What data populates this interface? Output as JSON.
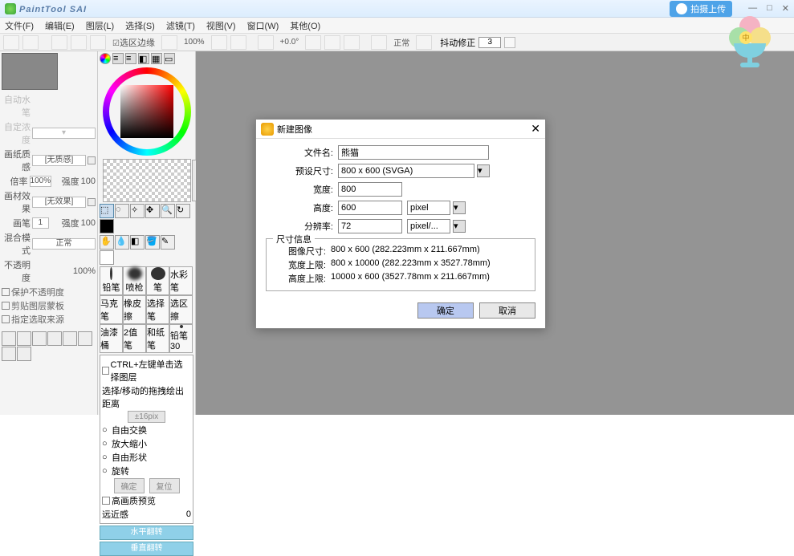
{
  "app": {
    "title": "PaintTool SAI",
    "upload_label": "拍摄上传"
  },
  "menu": [
    "文件(F)",
    "编辑(E)",
    "图层(L)",
    "选择(S)",
    "滤镜(T)",
    "视图(V)",
    "窗口(W)",
    "其他(O)"
  ],
  "toolbar": {
    "select_border": "选区边缘",
    "zoom": "100%",
    "angle": "+0.0°",
    "mode": "正常",
    "jitter_label": "抖动修正",
    "jitter_value": "3"
  },
  "left": {
    "paper_quality": "画纸质感",
    "paper_value": "[无质感]",
    "rate_label": "倍率",
    "rate_value": "100%",
    "intensity_label": "强度",
    "intensity_value": "100",
    "material_effect": "画材效果",
    "material_value": "[无效果]",
    "width_label": "画笔",
    "width_value": "1",
    "blend_label": "混合模式",
    "blend_value": "正常",
    "opacity_label": "不透明度",
    "opacity_value": "100%",
    "protect_alpha": "保护不透明度",
    "clip_mask": "剪贴图层蒙板",
    "select_src": "指定选取来源"
  },
  "brushes": [
    "铅笔",
    "喷枪",
    "笔",
    "水彩笔",
    "马克笔",
    "橡皮擦",
    "选择笔",
    "选区擦",
    "油漆桶",
    "2值笔",
    "和纸笔",
    "铅笔30"
  ],
  "opts": {
    "ctrl_hint": "CTRL+左键单击选择图层",
    "drag_hint": "选择/移动的拖拽绘出距离",
    "drag_val": "±16pix",
    "free_trans": "自由交换",
    "zoom_out": "放大缩小",
    "free_shape": "自由形状",
    "rotate": "旋转",
    "ok": "确定",
    "reset": "复位",
    "hq_preview": "高画质预览",
    "perspective": "远近感",
    "perspective_val": "0",
    "flip_h": "水平翻转",
    "flip_v": "垂直翻转"
  },
  "dialog": {
    "title": "新建图像",
    "filename_label": "文件名:",
    "filename_value": "熊猫",
    "preset_label": "预设尺寸:",
    "preset_value": "800 x 600 (SVGA)",
    "width_label": "宽度:",
    "width_value": "800",
    "height_label": "高度:",
    "height_value": "600",
    "unit_pixel": "pixel",
    "res_label": "分辨率:",
    "res_value": "72",
    "res_unit": "pixel/...",
    "info_title": "尺寸信息",
    "info_size_label": "图像尺寸:",
    "info_size": "800 x 600 (282.223mm x 211.667mm)",
    "info_wmax_label": "宽度上限:",
    "info_wmax": "800 x 10000 (282.223mm x 3527.78mm)",
    "info_hmax_label": "高度上限:",
    "info_hmax": "10000 x 600 (3527.78mm x 211.667mm)",
    "ok": "确定",
    "cancel": "取消"
  },
  "badge": "中"
}
